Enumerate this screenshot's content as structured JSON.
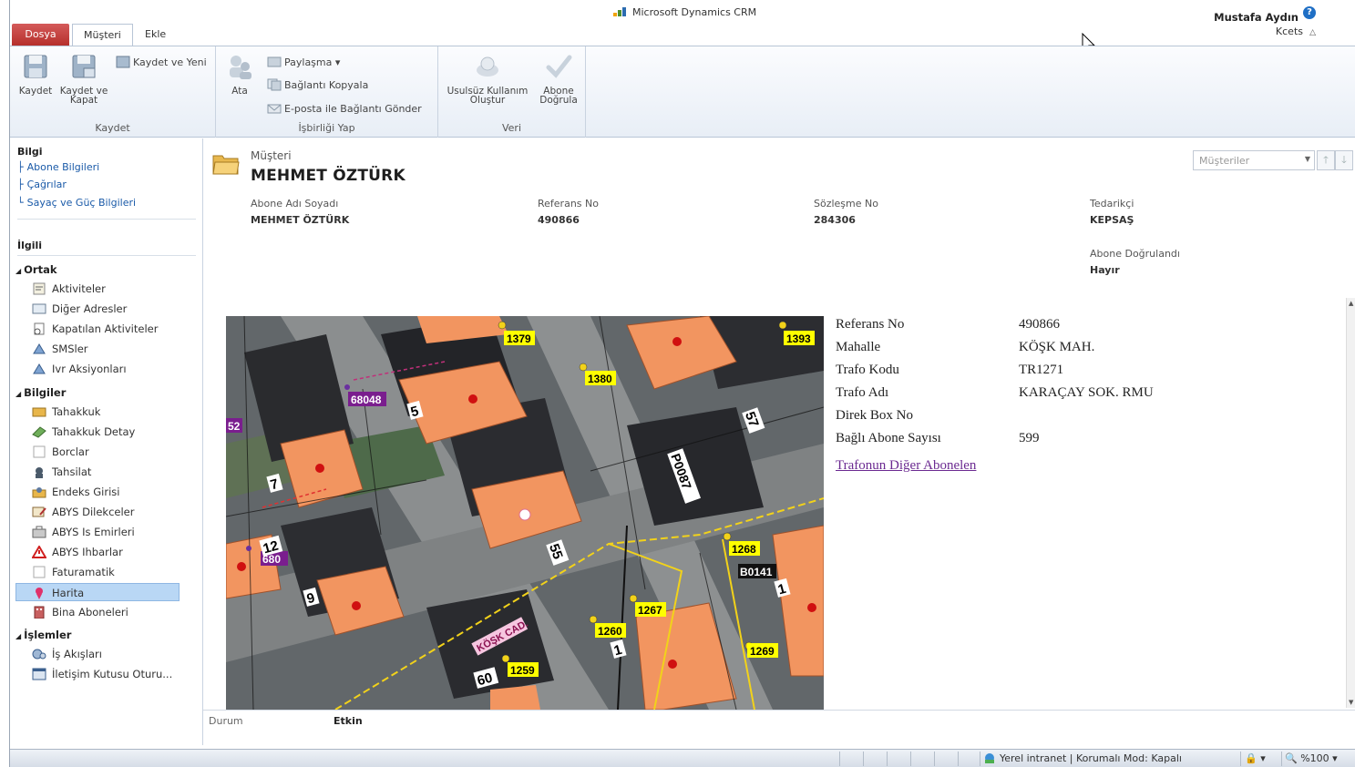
{
  "titlebar": {
    "app_title": "Microsoft Dynamics CRM",
    "user_name": "Mustafa Aydın",
    "org_name": "Kcets",
    "help": "?"
  },
  "tabs": [
    {
      "label": "Dosya"
    },
    {
      "label": "Müşteri"
    },
    {
      "label": "Ekle"
    }
  ],
  "ribbon": {
    "groups": [
      {
        "label": "Kaydet"
      },
      {
        "label": "İşbirliği Yap"
      },
      {
        "label": "Veri"
      }
    ],
    "save": "Kaydet",
    "save_close_1": "Kaydet ve",
    "save_close_2": "Kapat",
    "save_new": "Kaydet ve Yeni",
    "assign": "Ata",
    "share": "Paylaşma",
    "copy_link": "Bağlantı Kopyala",
    "email_link": "E-posta ile Bağlantı Gönder",
    "illegal_1": "Usulsüz Kullanım",
    "illegal_2": "Oluştur",
    "verify_1": "Abone",
    "verify_2": "Doğrula"
  },
  "nav": {
    "info_header": "Bilgi",
    "info_links": [
      "Abone Bilgileri",
      "Çağrılar",
      "Sayaç ve Güç Bilgileri"
    ],
    "related_header": "İlgili",
    "sections": [
      {
        "title": "Ortak",
        "items": [
          "Aktiviteler",
          "Diğer Adresler",
          "Kapatılan Aktiviteler",
          "SMSler",
          "Ivr Aksiyonları"
        ]
      },
      {
        "title": "Bilgiler",
        "items": [
          "Tahakkuk",
          "Tahakkuk Detay",
          "Borclar",
          "Tahsilat",
          "Endeks Girisi",
          "ABYS Dilekceler",
          "ABYS Is Emirleri",
          "ABYS Ihbarlar",
          "Faturamatik",
          "Harita",
          "Bina Aboneleri"
        ]
      },
      {
        "title": "İşlemler",
        "items": [
          "İş Akışları",
          "İletişim Kutusu Oturu..."
        ]
      }
    ],
    "selected": "Harita"
  },
  "record": {
    "entity_type": "Müşteri",
    "title": "MEHMET ÖZTÜRK",
    "view_select": "Müşteriler",
    "fields": [
      {
        "label": "Abone Adı Soyadı",
        "value": "MEHMET ÖZTÜRK"
      },
      {
        "label": "Referans No",
        "value": "490866"
      },
      {
        "label": "Sözleşme No",
        "value": "284306"
      },
      {
        "label": "Tedarikçi",
        "value": "KEPSAŞ"
      },
      {
        "label": "Abone Doğrulandı",
        "value": "Hayır"
      }
    ]
  },
  "map": {
    "labels": [
      "1379",
      "1393",
      "1380",
      "68048",
      "52",
      "P0087",
      "1268",
      "B0141",
      "1267",
      "1260",
      "1269",
      "1259",
      "KÖŞK CAD.",
      "12",
      "9",
      "5",
      "7",
      "55",
      "57",
      "1",
      "1",
      "60",
      "680"
    ]
  },
  "info": {
    "rows": [
      {
        "label": "Referans No",
        "value": "490866"
      },
      {
        "label": "Mahalle",
        "value": "KÖŞK MAH."
      },
      {
        "label": "Trafo Kodu",
        "value": "TR1271"
      },
      {
        "label": "Trafo Adı",
        "value": "KARAÇAY SOK. RMU"
      },
      {
        "label": "Direk Box No",
        "value": ""
      },
      {
        "label": "Bağlı Abone Sayısı",
        "value": "599"
      }
    ],
    "link": "Trafonun Diğer Abonelen"
  },
  "footer": {
    "status_label": "Durum",
    "status_value": "Etkin"
  },
  "statusbar": {
    "zone": "Yerel intranet | Korumalı Mod: Kapalı",
    "zoom": "%100"
  },
  "colors": {
    "accent": "#1a5aa8",
    "file_tab": "#c0403b",
    "selected_nav": "#b9d7f5",
    "map_label": "#ffff00",
    "roof": "#f29560"
  }
}
